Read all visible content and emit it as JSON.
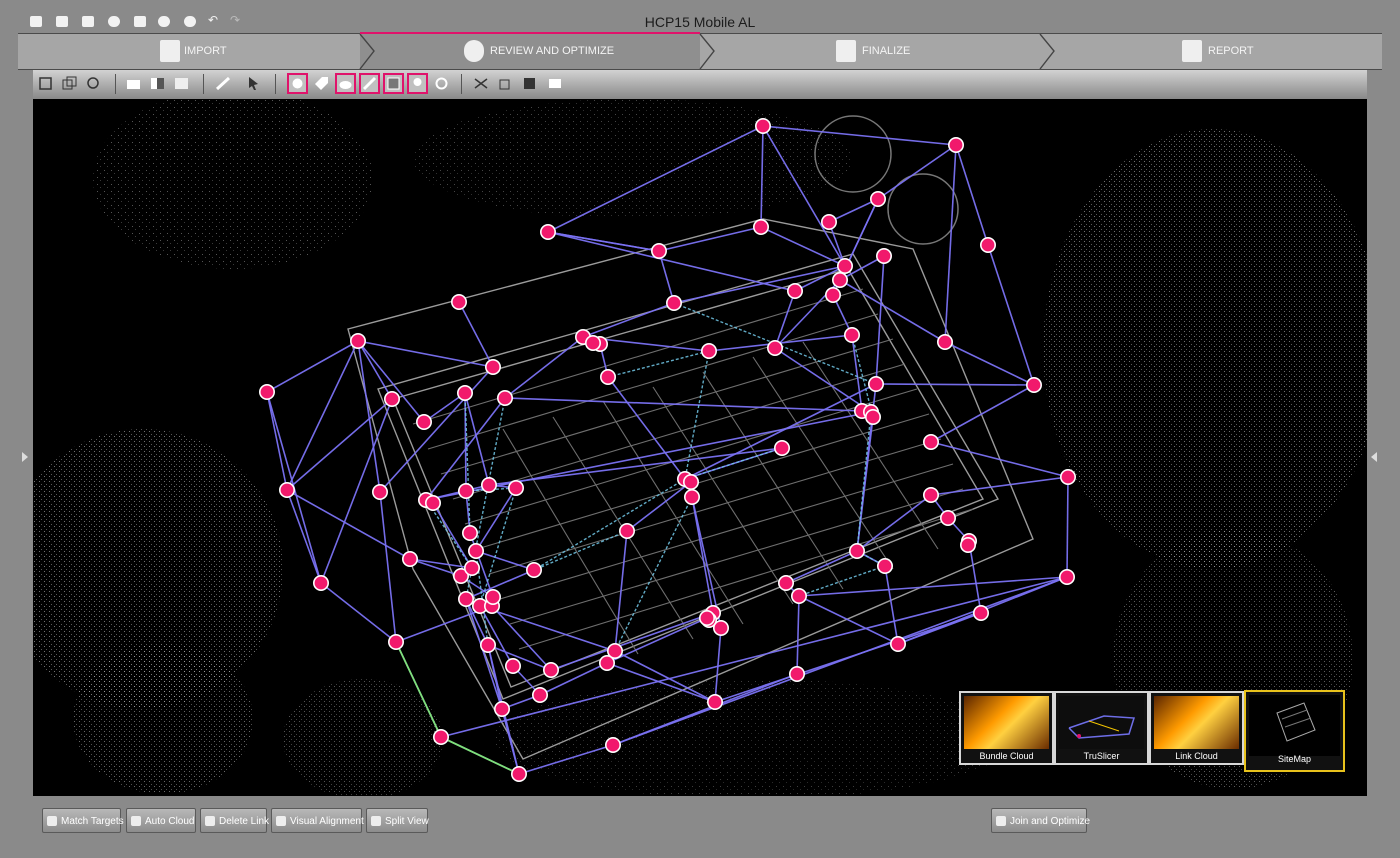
{
  "app": {
    "title": "HCP15 Mobile AL"
  },
  "quick_access": [
    "new-icon",
    "open-icon",
    "export-icon",
    "settings-icon",
    "save-icon",
    "help-icon",
    "info-icon",
    "undo-icon",
    "redo-icon"
  ],
  "steps": [
    {
      "label": "IMPORT",
      "icon": "import-icon",
      "active": false
    },
    {
      "label": "REVIEW AND OPTIMIZE",
      "icon": "review-icon",
      "active": true
    },
    {
      "label": "FINALIZE",
      "icon": "finalize-icon",
      "active": false
    },
    {
      "label": "REPORT",
      "icon": "report-icon",
      "active": false
    }
  ],
  "toolbar": {
    "tools": [
      "select-icon",
      "copy-icon",
      "zoom-fit-icon",
      "camera-icon",
      "split-icon",
      "square-icon",
      "measure-icon",
      "pointer-icon",
      "target-icon",
      "tag-icon",
      "cloud-icon",
      "ruler-icon",
      "image-icon",
      "pin-icon",
      "link-icon",
      "shuffle-icon",
      "transform-icon",
      "grid-icon",
      "display-icon"
    ]
  },
  "accent_color": "#e0136b",
  "map": {
    "link_color": "#7b72f4",
    "cloud_link_color": "#72c8e8",
    "selected_link_color": "#7fe07a",
    "node_color": "#f1196c",
    "node_count": 109
  },
  "thumbnails": [
    {
      "label": "Bundle Cloud",
      "selected": false
    },
    {
      "label": "TruSlicer",
      "selected": false
    },
    {
      "label": "Link Cloud",
      "selected": false
    },
    {
      "label": "SiteMap",
      "selected": true
    }
  ],
  "bottom_buttons": [
    {
      "label": "Match Targets",
      "icon": "match-targets-icon"
    },
    {
      "label": "Auto Cloud",
      "icon": "auto-cloud-icon"
    },
    {
      "label": "Delete Link",
      "icon": "delete-link-icon"
    },
    {
      "label": "Visual Alignment",
      "icon": "visual-alignment-icon"
    },
    {
      "label": "Split View",
      "icon": "split-view-icon"
    },
    {
      "label": "Join and Optimize",
      "icon": "join-optimize-icon"
    }
  ]
}
